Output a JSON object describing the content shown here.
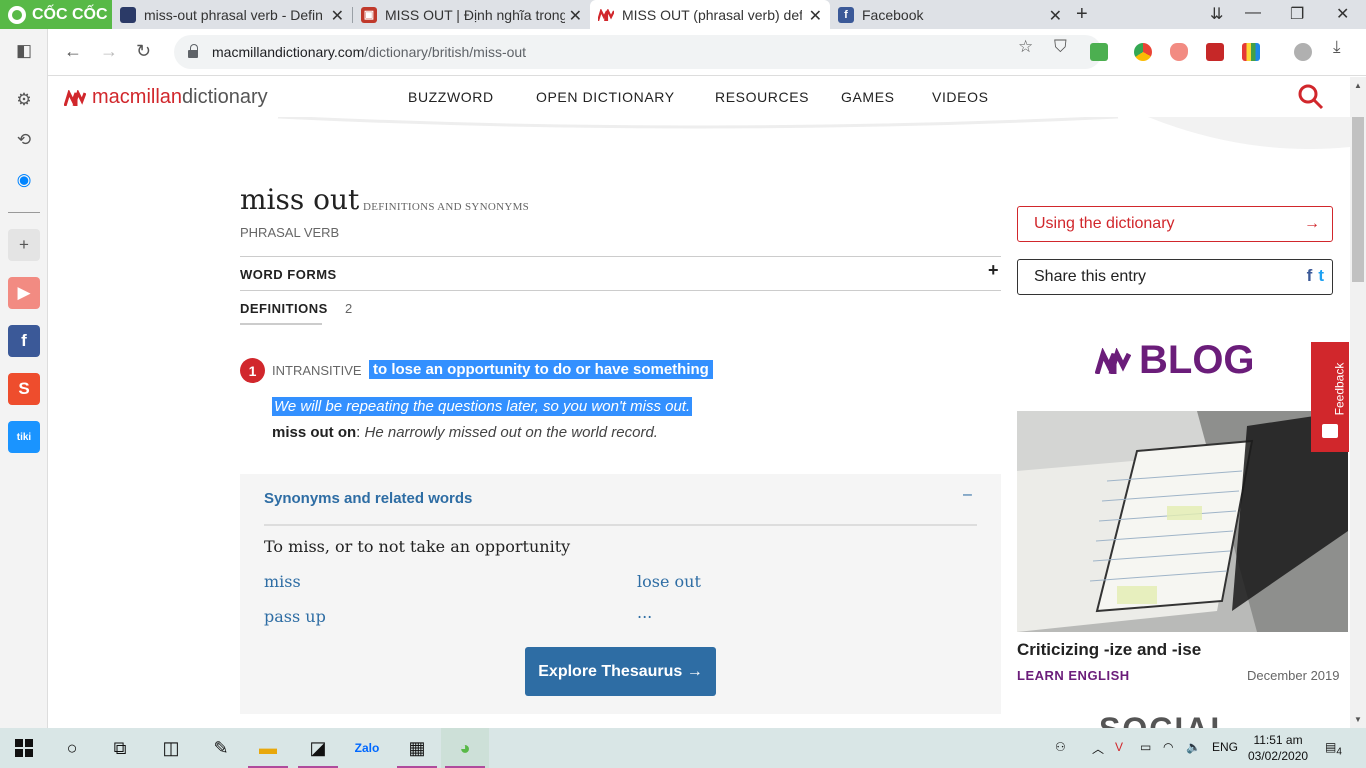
{
  "browser": {
    "brand": "CỐC CỐC",
    "tabs": [
      {
        "title": "miss-out phrasal verb - Defin",
        "favicon": "oxford-icon",
        "active": false
      },
      {
        "title": "MISS OUT | Định nghĩa trong",
        "favicon": "cambridge-icon",
        "active": false
      },
      {
        "title": "MISS OUT (phrasal verb) defi",
        "favicon": "macmillan-icon",
        "active": true
      },
      {
        "title": "Facebook",
        "favicon": "facebook-icon",
        "active": false
      }
    ],
    "url_domain": "macmillandictionary.com",
    "url_path": "/dictionary/british/miss-out"
  },
  "site": {
    "logo_part1": "macmillan",
    "logo_part2": "dictionary",
    "nav": [
      "BUZZWORD",
      "OPEN DICTIONARY",
      "RESOURCES",
      "GAMES",
      "VIDEOS"
    ]
  },
  "entry": {
    "headword": "miss out",
    "headword_sub": "DEFINITIONS AND SYNONYMS",
    "part_of_speech": "PHRASAL VERB",
    "word_forms_label": "WORD FORMS",
    "word_forms_toggle": "+",
    "definitions_label": "DEFINITIONS",
    "definitions_count": "2",
    "sense": {
      "number": "1",
      "grammar": "INTRANSITIVE",
      "definition": "to lose an opportunity to do or have something",
      "example1": "We will be repeating the questions later, so you won't miss out.",
      "example2_phrase": "miss out on",
      "example2_sep": ": ",
      "example2_text": "He narrowly missed out on the world record."
    },
    "synonyms": {
      "title": "Synonyms and related words",
      "toggle": "–",
      "heading": "To miss, or to not take an opportunity",
      "words": [
        "miss",
        "lose out",
        "pass up",
        "..."
      ],
      "button": "Explore Thesaurus →"
    }
  },
  "sidebar_right": {
    "using_dictionary": "Using the dictionary",
    "using_arrow": "→",
    "share": "Share this entry",
    "share_fb": "f",
    "share_tw": "t",
    "blog_label": "BLOG",
    "blog_post_title": "Criticizing -ize and -ise",
    "blog_category": "LEARN ENGLISH",
    "blog_date": "December 2019",
    "social_peek": "SOCIAL",
    "feedback": "Feedback"
  },
  "taskbar": {
    "language": "ENG",
    "time": "11:51 am",
    "date": "03/02/2020",
    "notifications": "4"
  },
  "colors": {
    "brand_red": "#d1272c",
    "link_blue": "#2e6da4",
    "blog_purple": "#6b1d7a",
    "selection": "#3390ff",
    "coccoc_green": "#58b947"
  }
}
